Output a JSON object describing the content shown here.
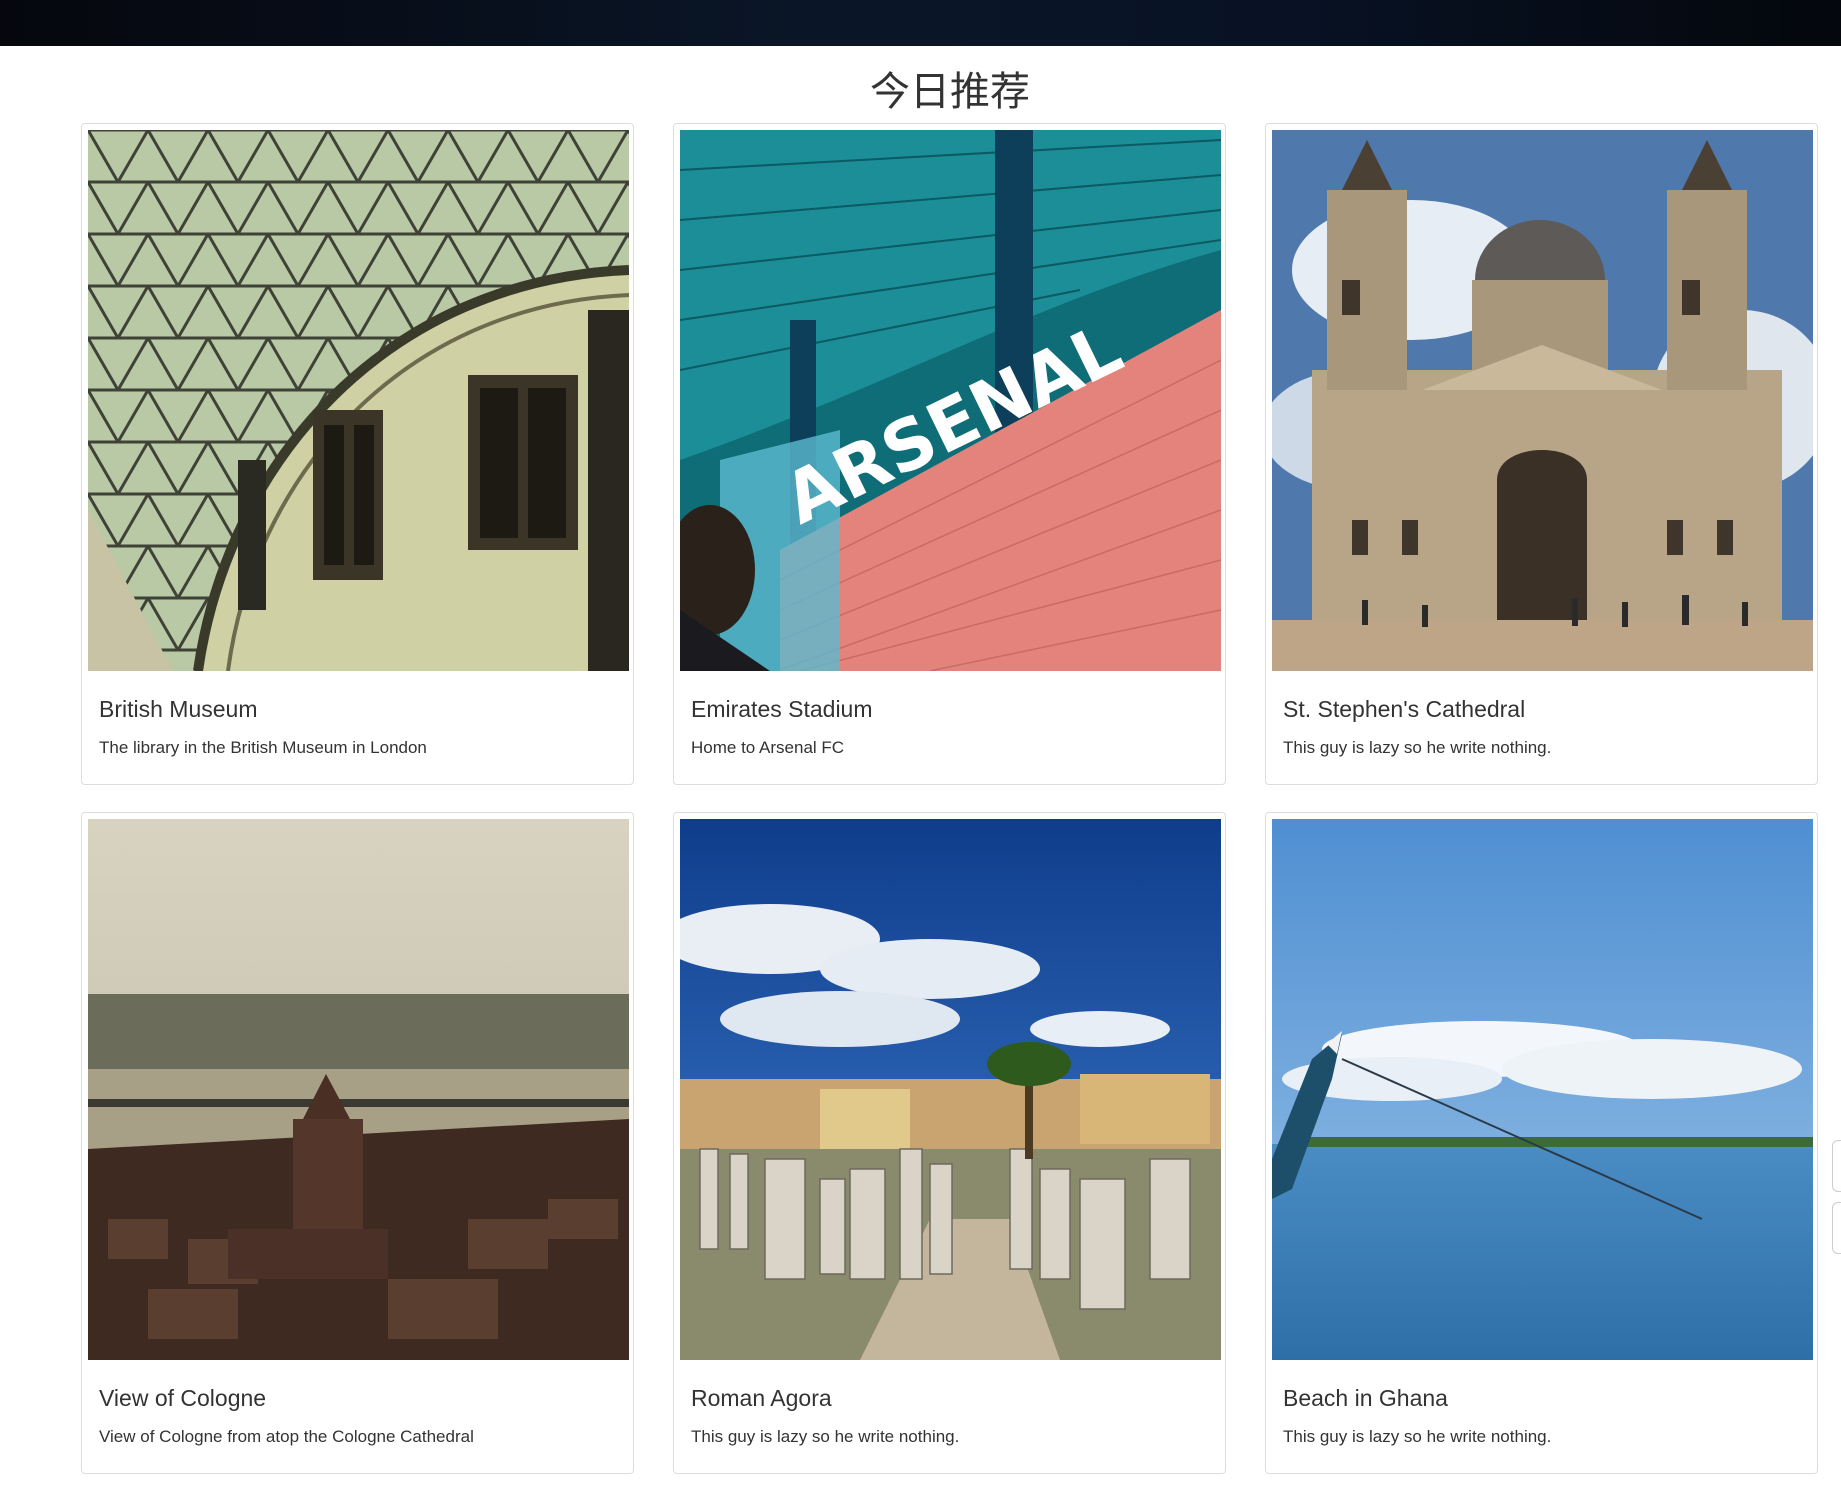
{
  "page": {
    "title": "今日推荐"
  },
  "cards": [
    {
      "title": "British Museum",
      "description": "The library in the British Museum in London",
      "image": "british-museum-dome-photo"
    },
    {
      "title": "Emirates Stadium",
      "description": "Home to Arsenal FC",
      "image": "arsenal-stadium-photo",
      "image_text": "ARSENAL"
    },
    {
      "title": "St. Stephen's Cathedral",
      "description": "This guy is lazy so he write nothing.",
      "image": "cathedral-photo"
    },
    {
      "title": "View of Cologne",
      "description": "View of Cologne from atop the Cologne Cathedral",
      "image": "cologne-cityscape-photo"
    },
    {
      "title": "Roman Agora",
      "description": "This guy is lazy so he write nothing.",
      "image": "roman-ruins-photo"
    },
    {
      "title": "Beach in Ghana",
      "description": "This guy is lazy so he write nothing.",
      "image": "ghana-sea-photo"
    }
  ],
  "colors": {
    "topbar": "#0a1628",
    "card_border": "#dddddd",
    "text": "#333333"
  }
}
